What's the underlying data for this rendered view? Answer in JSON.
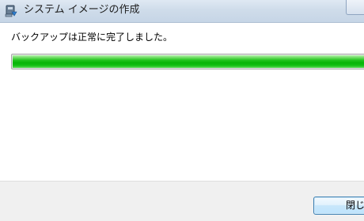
{
  "window": {
    "title": "システム イメージの作成"
  },
  "icons": {
    "app": "backup-app-icon"
  },
  "main": {
    "status": "バックアップは正常に完了しました。",
    "progress": {
      "percent": 100,
      "color": "#10bd10"
    }
  },
  "footer": {
    "close_label": "閉じる"
  }
}
